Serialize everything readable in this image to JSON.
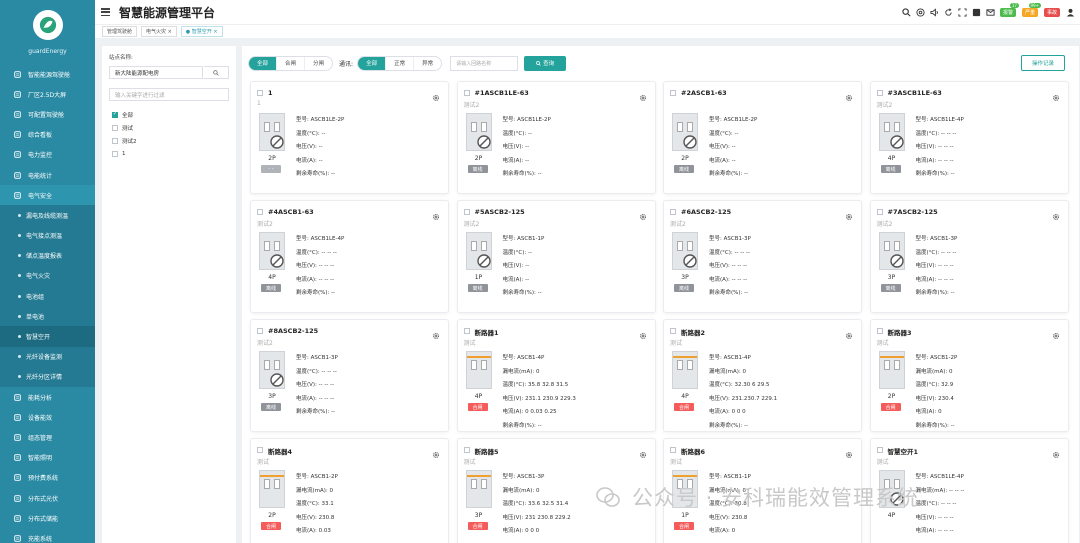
{
  "app": {
    "title": "智慧能源管理平台",
    "brand": "guardEnergy",
    "accent": "#24a39c",
    "sidebar_color": "#2a8aa3"
  },
  "sidebar": {
    "items": [
      {
        "label": "智能能源驾驶舱",
        "icon": "dashboard-icon",
        "type": "top"
      },
      {
        "label": "厂区2.5D大屏",
        "icon": "monitor-icon",
        "type": "top"
      },
      {
        "label": "可配置驾驶舱",
        "icon": "chart-icon",
        "type": "top"
      },
      {
        "label": "综合看板",
        "icon": "board-icon",
        "type": "top"
      },
      {
        "label": "电力监控",
        "icon": "globe-icon",
        "type": "top"
      },
      {
        "label": "电能统计",
        "icon": "bar-icon",
        "type": "top"
      },
      {
        "label": "电气安全",
        "icon": "safety-icon",
        "type": "open"
      },
      {
        "label": "漏电及线缆测温",
        "type": "sub"
      },
      {
        "label": "电气接点测温",
        "type": "sub"
      },
      {
        "label": "储点温度报表",
        "type": "sub"
      },
      {
        "label": "电气火灾",
        "type": "sub"
      },
      {
        "label": "电池组",
        "type": "sub"
      },
      {
        "label": "单电池",
        "type": "sub"
      },
      {
        "label": "智慧空开",
        "type": "sub",
        "active": true
      },
      {
        "label": "光纤设备监测",
        "type": "sub"
      },
      {
        "label": "光纤分区详情",
        "type": "sub"
      },
      {
        "label": "能耗分析",
        "icon": "globe-icon",
        "type": "top"
      },
      {
        "label": "设备能效",
        "icon": "gauge-icon",
        "type": "top"
      },
      {
        "label": "组态管理",
        "icon": "layout-icon",
        "type": "top"
      },
      {
        "label": "智能照明",
        "icon": "bulb-icon",
        "type": "top"
      },
      {
        "label": "预付费系统",
        "icon": "card-icon",
        "type": "top"
      },
      {
        "label": "分布式光伏",
        "icon": "solar-icon",
        "type": "top"
      },
      {
        "label": "分布式储能",
        "icon": "battery-icon",
        "type": "top"
      },
      {
        "label": "充能系统",
        "icon": "plug-icon",
        "type": "top"
      }
    ]
  },
  "header": {
    "badges": [
      {
        "label": "报警",
        "count": "17",
        "color": "#4cbb4c"
      },
      {
        "label": "严重",
        "count": "99+",
        "color": "#f5a623"
      },
      {
        "label": "事故",
        "count": "",
        "color": "#e84d4d"
      }
    ]
  },
  "tabs": [
    {
      "label": "管理驾驶舱",
      "active": false
    },
    {
      "label": "电气火灾 ×",
      "active": false
    },
    {
      "label": "● 智慧空开 ×",
      "active": true
    }
  ],
  "left_panel": {
    "station_label": "站点名称:",
    "station_value": "新大陆能源配电房",
    "filter_placeholder": "输入关键字进行过滤",
    "tree": [
      {
        "label": "全部",
        "checked": true
      },
      {
        "label": "测试",
        "checked": false
      },
      {
        "label": "测试2",
        "checked": false
      },
      {
        "label": "1",
        "checked": false
      }
    ]
  },
  "filters": {
    "mode_options": [
      "全部",
      "合闸",
      "分闸"
    ],
    "comm_label": "通讯:",
    "comm_options": [
      "全部",
      "正常",
      "异常"
    ],
    "search_placeholder": "请输入回路名称",
    "query_label": "查询",
    "op_log_label": "操作记录"
  },
  "labels": {
    "model": "型号:",
    "temp": "温度(°C):",
    "voltage": "电压(V):",
    "current": "电流(A):",
    "life": "剩余寿命(%):",
    "leak": "漏电流(mA):"
  },
  "cards": [
    {
      "name": "1",
      "sub": "1",
      "model": "ASCB1LE-2P",
      "pole": "2P",
      "status": "- -",
      "stype": "none",
      "rows": [
        [
          "temp",
          "--"
        ],
        [
          "voltage",
          "--"
        ],
        [
          "current",
          "--"
        ],
        [
          "life",
          "--"
        ]
      ]
    },
    {
      "name": "#1ASCB1LE-63",
      "sub": "测试2",
      "model": "ASCB1LE-2P",
      "pole": "2P",
      "status": "离线",
      "stype": "off",
      "rows": [
        [
          "temp",
          "--"
        ],
        [
          "voltage",
          "--"
        ],
        [
          "current",
          "--"
        ],
        [
          "life",
          "--"
        ]
      ]
    },
    {
      "name": "#2ASCB1-63",
      "sub": "",
      "model": "ASCB1LE-2P",
      "pole": "2P",
      "status": "离线",
      "stype": "off",
      "rows": [
        [
          "temp",
          "--"
        ],
        [
          "voltage",
          "--"
        ],
        [
          "current",
          "--"
        ],
        [
          "life",
          "--"
        ]
      ]
    },
    {
      "name": "#3ASCB1LE-63",
      "sub": "测试2",
      "model": "ASCB1LE-4P",
      "pole": "4P",
      "status": "离线",
      "stype": "off",
      "rows": [
        [
          "temp",
          "-- -- --"
        ],
        [
          "voltage",
          "-- -- --"
        ],
        [
          "current",
          "-- -- --"
        ],
        [
          "life",
          "--"
        ]
      ]
    },
    {
      "name": "#4ASCB1-63",
      "sub": "测试2",
      "model": "ASCB1LE-4P",
      "pole": "4P",
      "status": "离线",
      "stype": "off",
      "rows": [
        [
          "temp",
          "-- -- --"
        ],
        [
          "voltage",
          "-- -- --"
        ],
        [
          "current",
          "-- -- --"
        ],
        [
          "life",
          "--"
        ]
      ]
    },
    {
      "name": "#5ASCB2-125",
      "sub": "测试2",
      "model": "ASCB1-1P",
      "pole": "1P",
      "status": "离线",
      "stype": "off",
      "rows": [
        [
          "temp",
          "--"
        ],
        [
          "voltage",
          "--"
        ],
        [
          "current",
          "--"
        ],
        [
          "life",
          "--"
        ]
      ]
    },
    {
      "name": "#6ASCB2-125",
      "sub": "测试2",
      "model": "ASCB1-3P",
      "pole": "3P",
      "status": "离线",
      "stype": "off",
      "rows": [
        [
          "temp",
          "-- -- --"
        ],
        [
          "voltage",
          "-- -- --"
        ],
        [
          "current",
          "-- -- --"
        ],
        [
          "life",
          "--"
        ]
      ]
    },
    {
      "name": "#7ASCB2-125",
      "sub": "测试2",
      "model": "ASCB1-3P",
      "pole": "3P",
      "status": "离线",
      "stype": "off",
      "rows": [
        [
          "temp",
          "-- -- --"
        ],
        [
          "voltage",
          "-- -- --"
        ],
        [
          "current",
          "-- -- --"
        ],
        [
          "life",
          "--"
        ]
      ]
    },
    {
      "name": "#8ASCB2-125",
      "sub": "测试2",
      "model": "ASCB1-3P",
      "pole": "3P",
      "status": "离线",
      "stype": "off",
      "rows": [
        [
          "temp",
          "-- -- --"
        ],
        [
          "voltage",
          "-- -- --"
        ],
        [
          "current",
          "-- -- --"
        ],
        [
          "life",
          "--"
        ]
      ]
    },
    {
      "name": "断路器1",
      "sub": "测试",
      "model": "ASCB1-4P",
      "pole": "4P",
      "status": "合闸",
      "stype": "on",
      "rows": [
        [
          "leak",
          "0"
        ],
        [
          "temp",
          "35.8 32.8 31.5"
        ],
        [
          "voltage",
          "231.1 230.9 229.3"
        ],
        [
          "current",
          "0 0.03 0.25"
        ],
        [
          "life",
          "--"
        ]
      ]
    },
    {
      "name": "断路器2",
      "sub": "测试",
      "model": "ASCB1-4P",
      "pole": "4P",
      "status": "合闸",
      "stype": "on",
      "rows": [
        [
          "leak",
          "0"
        ],
        [
          "temp",
          "32.30 6 29.5"
        ],
        [
          "voltage",
          "231.230.7 229.1"
        ],
        [
          "current",
          "0 0 0"
        ],
        [
          "life",
          "--"
        ]
      ]
    },
    {
      "name": "断路器3",
      "sub": "测试",
      "model": "ASCB1-2P",
      "pole": "2P",
      "status": "合闸",
      "stype": "on",
      "rows": [
        [
          "leak",
          "0"
        ],
        [
          "temp",
          "32.9"
        ],
        [
          "voltage",
          "230.4"
        ],
        [
          "current",
          "0"
        ],
        [
          "life",
          "--"
        ]
      ]
    },
    {
      "name": "断路器4",
      "sub": "测试",
      "model": "ASCB1-2P",
      "pole": "2P",
      "status": "合闸",
      "stype": "on",
      "rows": [
        [
          "leak",
          "0"
        ],
        [
          "temp",
          "33.1"
        ],
        [
          "voltage",
          "230.8"
        ],
        [
          "current",
          "0.03"
        ]
      ]
    },
    {
      "name": "断路器5",
      "sub": "测试",
      "model": "ASCB1-3P",
      "pole": "3P",
      "status": "合闸",
      "stype": "on",
      "rows": [
        [
          "leak",
          "0"
        ],
        [
          "temp",
          "33.6 32.5 31.4"
        ],
        [
          "voltage",
          "231 230.8 229.2"
        ],
        [
          "current",
          "0 0 0"
        ]
      ]
    },
    {
      "name": "断路器6",
      "sub": "测试",
      "model": "ASCB1-1P",
      "pole": "1P",
      "status": "合闸",
      "stype": "on",
      "rows": [
        [
          "leak",
          "0"
        ],
        [
          "temp",
          "30.8"
        ],
        [
          "voltage",
          "230.8"
        ],
        [
          "current",
          "0"
        ]
      ]
    },
    {
      "name": "智慧空开1",
      "sub": "测试",
      "model": "ASCB1LE-4P",
      "pole": "4P",
      "status": "",
      "stype": "none",
      "rows": [
        [
          "leak",
          "-- -- --"
        ],
        [
          "temp",
          "-- -- --"
        ],
        [
          "voltage",
          "-- -- --"
        ],
        [
          "current",
          "-- -- --"
        ]
      ]
    }
  ],
  "watermark": "公众号 · 安科瑞能效管理系统"
}
